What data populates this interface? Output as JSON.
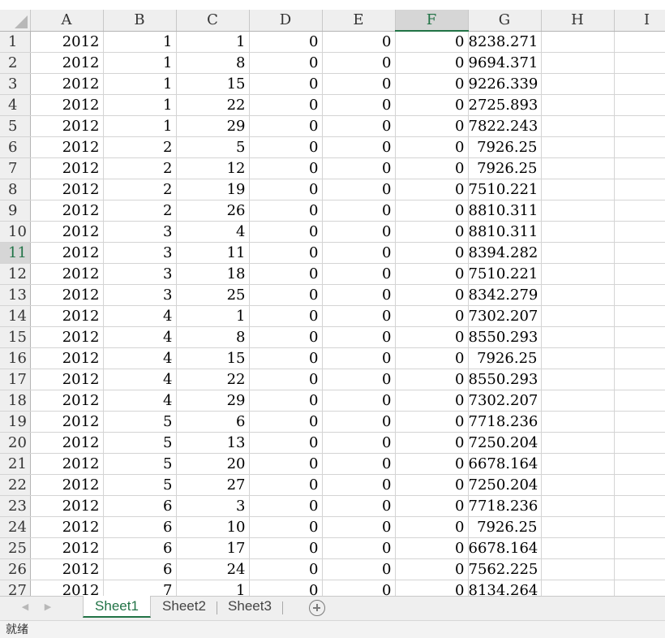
{
  "columns": [
    "A",
    "B",
    "C",
    "D",
    "E",
    "F",
    "G",
    "H",
    "I"
  ],
  "selected_column": "F",
  "selected_row": "11",
  "rows": [
    {
      "n": "1",
      "cells": [
        "2012",
        "1",
        "1",
        "0",
        "0",
        "0",
        "8238.271",
        "",
        ""
      ]
    },
    {
      "n": "2",
      "cells": [
        "2012",
        "1",
        "8",
        "0",
        "0",
        "0",
        "9694.371",
        "",
        ""
      ]
    },
    {
      "n": "3",
      "cells": [
        "2012",
        "1",
        "15",
        "0",
        "0",
        "0",
        "9226.339",
        "",
        ""
      ]
    },
    {
      "n": "4",
      "cells": [
        "2012",
        "1",
        "22",
        "0",
        "0",
        "0",
        "2725.893",
        "",
        ""
      ]
    },
    {
      "n": "5",
      "cells": [
        "2012",
        "1",
        "29",
        "0",
        "0",
        "0",
        "7822.243",
        "",
        ""
      ]
    },
    {
      "n": "6",
      "cells": [
        "2012",
        "2",
        "5",
        "0",
        "0",
        "0",
        "7926.25",
        "",
        ""
      ]
    },
    {
      "n": "7",
      "cells": [
        "2012",
        "2",
        "12",
        "0",
        "0",
        "0",
        "7926.25",
        "",
        ""
      ]
    },
    {
      "n": "8",
      "cells": [
        "2012",
        "2",
        "19",
        "0",
        "0",
        "0",
        "7510.221",
        "",
        ""
      ]
    },
    {
      "n": "9",
      "cells": [
        "2012",
        "2",
        "26",
        "0",
        "0",
        "0",
        "8810.311",
        "",
        ""
      ]
    },
    {
      "n": "10",
      "cells": [
        "2012",
        "3",
        "4",
        "0",
        "0",
        "0",
        "8810.311",
        "",
        ""
      ]
    },
    {
      "n": "11",
      "cells": [
        "2012",
        "3",
        "11",
        "0",
        "0",
        "0",
        "8394.282",
        "",
        ""
      ]
    },
    {
      "n": "12",
      "cells": [
        "2012",
        "3",
        "18",
        "0",
        "0",
        "0",
        "7510.221",
        "",
        ""
      ]
    },
    {
      "n": "13",
      "cells": [
        "2012",
        "3",
        "25",
        "0",
        "0",
        "0",
        "8342.279",
        "",
        ""
      ]
    },
    {
      "n": "14",
      "cells": [
        "2012",
        "4",
        "1",
        "0",
        "0",
        "0",
        "7302.207",
        "",
        ""
      ]
    },
    {
      "n": "15",
      "cells": [
        "2012",
        "4",
        "8",
        "0",
        "0",
        "0",
        "8550.293",
        "",
        ""
      ]
    },
    {
      "n": "16",
      "cells": [
        "2012",
        "4",
        "15",
        "0",
        "0",
        "0",
        "7926.25",
        "",
        ""
      ]
    },
    {
      "n": "17",
      "cells": [
        "2012",
        "4",
        "22",
        "0",
        "0",
        "0",
        "8550.293",
        "",
        ""
      ]
    },
    {
      "n": "18",
      "cells": [
        "2012",
        "4",
        "29",
        "0",
        "0",
        "0",
        "7302.207",
        "",
        ""
      ]
    },
    {
      "n": "19",
      "cells": [
        "2012",
        "5",
        "6",
        "0",
        "0",
        "0",
        "7718.236",
        "",
        ""
      ]
    },
    {
      "n": "20",
      "cells": [
        "2012",
        "5",
        "13",
        "0",
        "0",
        "0",
        "7250.204",
        "",
        ""
      ]
    },
    {
      "n": "21",
      "cells": [
        "2012",
        "5",
        "20",
        "0",
        "0",
        "0",
        "6678.164",
        "",
        ""
      ]
    },
    {
      "n": "22",
      "cells": [
        "2012",
        "5",
        "27",
        "0",
        "0",
        "0",
        "7250.204",
        "",
        ""
      ]
    },
    {
      "n": "23",
      "cells": [
        "2012",
        "6",
        "3",
        "0",
        "0",
        "0",
        "7718.236",
        "",
        ""
      ]
    },
    {
      "n": "24",
      "cells": [
        "2012",
        "6",
        "10",
        "0",
        "0",
        "0",
        "7926.25",
        "",
        ""
      ]
    },
    {
      "n": "25",
      "cells": [
        "2012",
        "6",
        "17",
        "0",
        "0",
        "0",
        "6678.164",
        "",
        ""
      ]
    },
    {
      "n": "26",
      "cells": [
        "2012",
        "6",
        "24",
        "0",
        "0",
        "0",
        "7562.225",
        "",
        ""
      ]
    },
    {
      "n": "27",
      "cells": [
        "2012",
        "7",
        "1",
        "0",
        "0",
        "0",
        "8134.264",
        "",
        ""
      ]
    }
  ],
  "tabs": {
    "sheet1": "Sheet1",
    "sheet2": "Sheet2",
    "sheet3": "Sheet3",
    "active": "Sheet1"
  },
  "icons": {
    "prev": "chevron-left-icon",
    "next": "chevron-right-icon",
    "add": "plus-circle-icon"
  },
  "status": {
    "text": "就绪"
  },
  "colors": {
    "accent": "#217346",
    "header_bg": "#efefef",
    "gridline": "#d4d4d4"
  }
}
